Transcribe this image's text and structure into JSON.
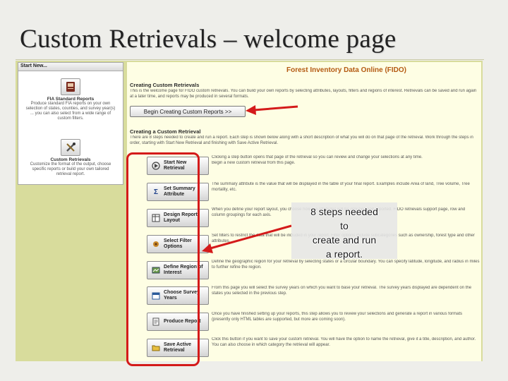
{
  "slide": {
    "title": "Custom Retrievals – welcome page"
  },
  "sidebar": {
    "header": "Start New...",
    "items": [
      {
        "title": "FIA Standard Reports",
        "text": "Produce standard FIA reports on your own selection of states, counties, and survey year(s) ... you can also select from a wide range of custom filters."
      },
      {
        "title": "Custom Retrievals",
        "text": "Customize the format of the output, choose specific reports or build your own tailored retrieval report."
      }
    ]
  },
  "main": {
    "app_title": "Forest Inventory Data Online (FIDO)",
    "creating_heading": "Creating Custom Retrievals",
    "creating_text": "This is the welcome page for FIDO custom retrievals. You can build your own reports by selecting attributes, layouts, filters and regions of interest. Retrievals can be saved and run again at a later time, and reports may be produced in several formats.",
    "begin_button": "Begin Creating Custom Reports >>",
    "retrieval_heading": "Creating a Custom Retrieval",
    "retrieval_text": "There are 8 steps needed to create and run a report. Each step is shown below along with a short description of what you will do on that page of the retrieval. Work through the steps in order, starting with Start New Retrieval and finishing with Save Active Retrieval.",
    "intro_text": "Clicking a step button opens that page of the retrieval so you can review and change your selections at any time.",
    "steps": [
      {
        "label": "Start New Retrieval",
        "icon": "start-icon",
        "desc": "Begin a new custom retrieval from this page."
      },
      {
        "label": "Set Summary Attribute",
        "icon": "sigma-icon",
        "desc": "The summary attribute is the value that will be displayed in the table of your final report. Examples include Area of land, Tree volume, Tree mortality, etc."
      },
      {
        "label": "Design Report Layout",
        "icon": "layout-icon",
        "desc": "When you define your report layout, you choose how the attributes will be grouped and reported. FIDO retrievals support page, row and column groupings for each axis."
      },
      {
        "label": "Select Filter Options",
        "icon": "filter-icon",
        "desc": "Set filters to restrict the data that will be included in your report. Filter options include subcategories such as ownership, forest type and other attributes."
      },
      {
        "label": "Define Region of Interest",
        "icon": "map-icon",
        "desc": "Define the geographic region for your retrieval by selecting states or a circular boundary. You can specify latitude, longitude, and radius in miles to further refine the region."
      },
      {
        "label": "Choose Survey Years",
        "icon": "calendar-icon",
        "desc": "From this page you will select the survey years on which you want to base your retrieval. The survey years displayed are dependent on the states you selected in the previous step."
      },
      {
        "label": "Produce Report",
        "icon": "report-icon",
        "desc": "Once you have finished setting up your reports, this step allows you to review your selections and generate a report in various formats (presently only HTML tables are supported, but more are coming soon)."
      },
      {
        "label": "Save Active Retrieval",
        "icon": "folder-icon",
        "desc": "Click this button if you want to save your custom retrieval. You will have the option to name the retrieval, give it a title, description, and author. You can also choose in which category the retrieval will appear."
      }
    ]
  },
  "annotation": {
    "callout_line1": "8 steps  needed",
    "callout_line2": "to",
    "callout_line3": "create and run",
    "callout_line4": "a report."
  },
  "colors": {
    "accent": "#b45a12",
    "highlight": "#d41a1a",
    "frame": "#d8dc9c"
  }
}
